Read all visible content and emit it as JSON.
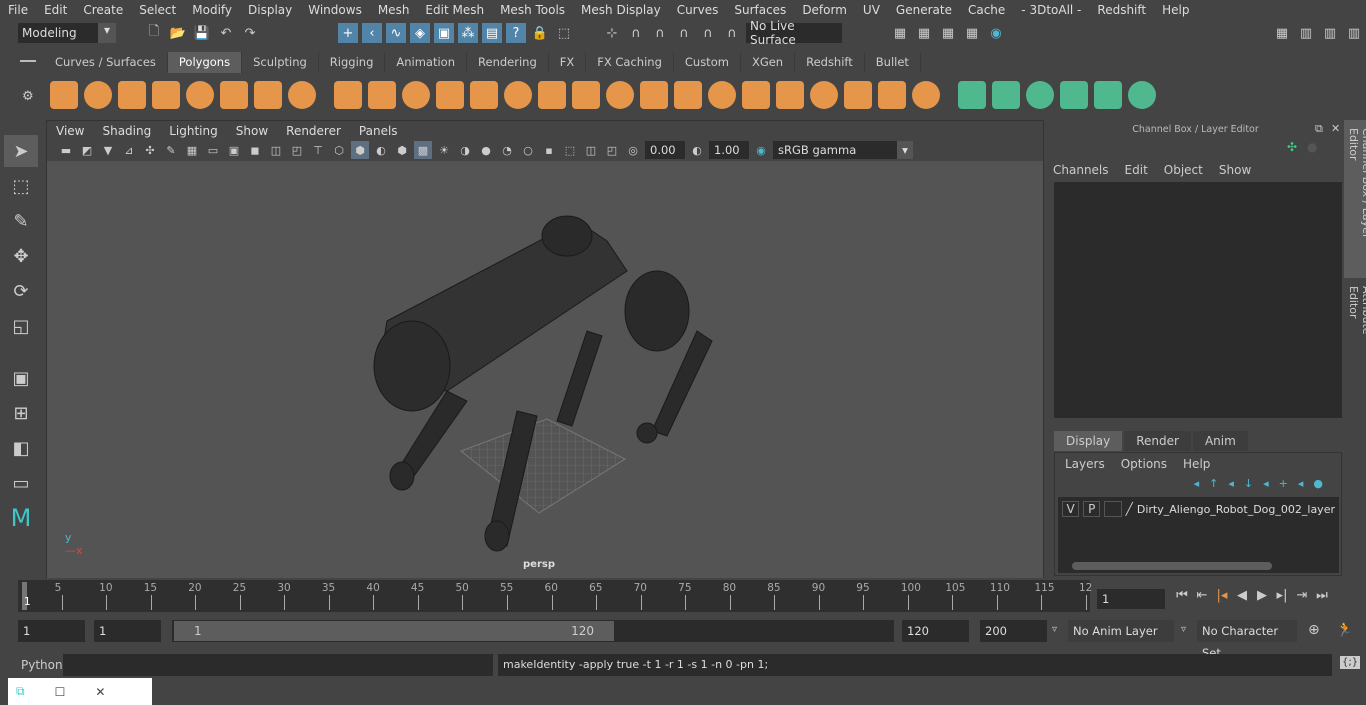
{
  "menu": [
    "File",
    "Edit",
    "Create",
    "Select",
    "Modify",
    "Display",
    "Windows",
    "Mesh",
    "Edit Mesh",
    "Mesh Tools",
    "Mesh Display",
    "Curves",
    "Surfaces",
    "Deform",
    "UV",
    "Generate",
    "Cache",
    "- 3DtoAll -",
    "Redshift",
    "Help"
  ],
  "status": {
    "workspace": "Modeling",
    "live_surface": "No Live Surface"
  },
  "shelf": {
    "tabs": [
      "Curves / Surfaces",
      "Polygons",
      "Sculpting",
      "Rigging",
      "Animation",
      "Rendering",
      "FX",
      "FX Caching",
      "Custom",
      "XGen",
      "Redshift",
      "Bullet"
    ],
    "active": "Polygons",
    "orange": "#e5964a",
    "green": "#4fb88f"
  },
  "viewport": {
    "menu": [
      "View",
      "Shading",
      "Lighting",
      "Show",
      "Renderer",
      "Panels"
    ],
    "exposure": "0.00",
    "gamma": "1.00",
    "color_space": "sRGB gamma",
    "camera": "persp"
  },
  "channel_box": {
    "title": "Channel Box / Layer Editor",
    "menu": [
      "Channels",
      "Edit",
      "Object",
      "Show"
    ]
  },
  "layer_editor": {
    "tabs": [
      "Display",
      "Render",
      "Anim"
    ],
    "active": "Display",
    "menu": [
      "Layers",
      "Options",
      "Help"
    ],
    "layer": {
      "v": "V",
      "p": "P",
      "name": "Dirty_Aliengo_Robot_Dog_002_layer"
    }
  },
  "side_tabs": [
    "Channel Box / Layer Editor",
    "Attribute Editor"
  ],
  "timeline": {
    "ticks": [
      "5",
      "10",
      "15",
      "20",
      "25",
      "30",
      "35",
      "40",
      "45",
      "50",
      "55",
      "60",
      "65",
      "70",
      "75",
      "80",
      "85",
      "90",
      "95",
      "100",
      "105",
      "110",
      "115",
      "12"
    ],
    "current_label": "1",
    "current_frame": "1"
  },
  "range": {
    "start": "1",
    "playback_start": "1",
    "slider_start": "1",
    "slider_end": "120",
    "playback_end": "120",
    "end": "200",
    "anim_layer": "No Anim Layer",
    "character_set": "No Character Set"
  },
  "command": {
    "language": "Python",
    "input": "",
    "output": "makeIdentity -apply true -t 1 -r 1 -s 1 -n 0 -pn 1;"
  }
}
